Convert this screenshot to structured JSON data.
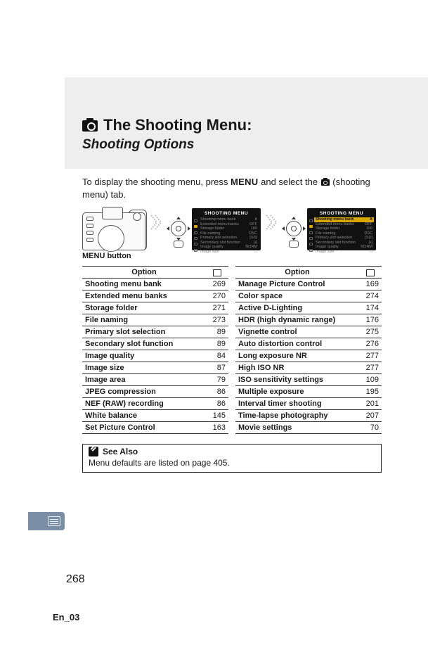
{
  "header": {
    "title": "The Shooting Menu:",
    "subtitle": "Shooting Options"
  },
  "intro": {
    "before_menu": "To display the shooting menu, press ",
    "menu_label": "MENU",
    "between": " and select the ",
    "after_icon": " (shooting menu) tab."
  },
  "illus": {
    "label": "MENU button",
    "lcd_title": "SHOOTING MENU",
    "lcd_items": [
      {
        "name": "Shooting menu bank",
        "val": "A"
      },
      {
        "name": "Extended menu banks",
        "val": "OFF"
      },
      {
        "name": "Storage folder",
        "val": "100"
      },
      {
        "name": "File naming",
        "val": "DSC"
      },
      {
        "name": "Primary slot selection",
        "val": "[SD]"
      },
      {
        "name": "Secondary slot function",
        "val": "[•]"
      },
      {
        "name": "Image quality",
        "val": "NORM"
      },
      {
        "name": "Image size",
        "val": "□"
      }
    ]
  },
  "table_header": {
    "option": "Option",
    "page_icon_alt": "page"
  },
  "left_options": [
    {
      "name": "Shooting menu bank",
      "page": 269
    },
    {
      "name": "Extended menu banks",
      "page": 270
    },
    {
      "name": "Storage folder",
      "page": 271
    },
    {
      "name": "File naming",
      "page": 273
    },
    {
      "name": "Primary slot selection",
      "page": 89
    },
    {
      "name": "Secondary slot function",
      "page": 89
    },
    {
      "name": "Image quality",
      "page": 84
    },
    {
      "name": "Image size",
      "page": 87
    },
    {
      "name": "Image area",
      "page": 79
    },
    {
      "name": "JPEG compression",
      "page": 86
    },
    {
      "name": "NEF (RAW) recording",
      "page": 86
    },
    {
      "name": "White balance",
      "page": 145
    },
    {
      "name": "Set Picture Control",
      "page": 163
    }
  ],
  "right_options": [
    {
      "name": "Manage Picture Control",
      "page": 169
    },
    {
      "name": "Color space",
      "page": 274
    },
    {
      "name": "Active D-Lighting",
      "page": 174
    },
    {
      "name": "HDR (high dynamic range)",
      "page": 176
    },
    {
      "name": "Vignette control",
      "page": 275
    },
    {
      "name": "Auto distortion control",
      "page": 276
    },
    {
      "name": "Long exposure NR",
      "page": 277
    },
    {
      "name": "High ISO NR",
      "page": 277
    },
    {
      "name": "ISO sensitivity settings",
      "page": 109
    },
    {
      "name": "Multiple exposure",
      "page": 195
    },
    {
      "name": "Interval timer shooting",
      "page": 201
    },
    {
      "name": "Time-lapse photography",
      "page": 207
    },
    {
      "name": "Movie settings",
      "page": 70
    }
  ],
  "see_also": {
    "title": "See Also",
    "body": "Menu defaults are listed on page 405."
  },
  "page_number": "268",
  "footer_code": "En_03"
}
